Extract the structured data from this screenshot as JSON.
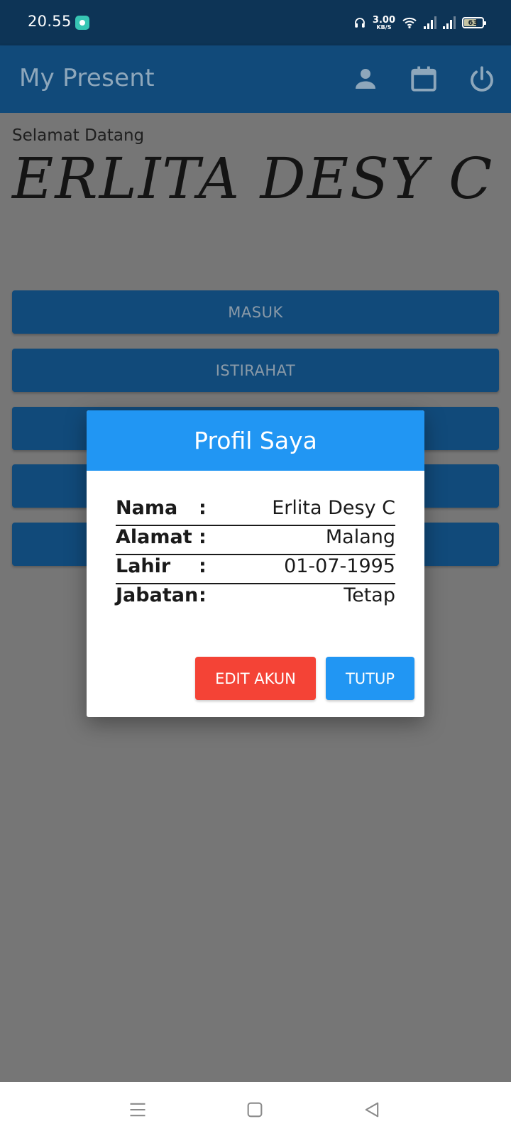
{
  "status_bar": {
    "time": "20.55",
    "net_speed_value": "3.00",
    "net_speed_unit": "KB/S",
    "battery_level": "63",
    "icons": [
      "notification-app-icon",
      "headphones-icon",
      "wifi-icon",
      "signal-1-icon",
      "signal-2-icon",
      "battery-icon"
    ]
  },
  "app_bar": {
    "title": "My Present",
    "icons": [
      "person-icon",
      "calendar-icon",
      "power-icon"
    ]
  },
  "main": {
    "welcome": "Selamat Datang",
    "user_name": "ERLITA DESY C",
    "buttons": [
      {
        "label": "MASUK"
      },
      {
        "label": "ISTIRAHAT"
      },
      {
        "label": ""
      },
      {
        "label": ""
      },
      {
        "label": ""
      }
    ]
  },
  "dialog": {
    "title": "Profil Saya",
    "rows": [
      {
        "label": "Nama",
        "colon": ":",
        "value": "Erlita Desy C"
      },
      {
        "label": "Alamat",
        "colon": ":",
        "value": "Malang"
      },
      {
        "label": "Lahir",
        "colon": ":",
        "value": "01-07-1995"
      },
      {
        "label": "Jabatan",
        "colon": ":",
        "value": "Tetap"
      }
    ],
    "edit_label": "EDIT AKUN",
    "close_label": "TUTUP"
  },
  "nav_bar": {
    "icons": [
      "menu-icon",
      "home-icon",
      "back-icon"
    ]
  },
  "colors": {
    "status_bar": "#0d3456",
    "app_bar": "#114a7a",
    "overlay": "#767676",
    "dialog_header": "#2196f3",
    "edit_button": "#f44336",
    "close_button": "#2196f3"
  }
}
